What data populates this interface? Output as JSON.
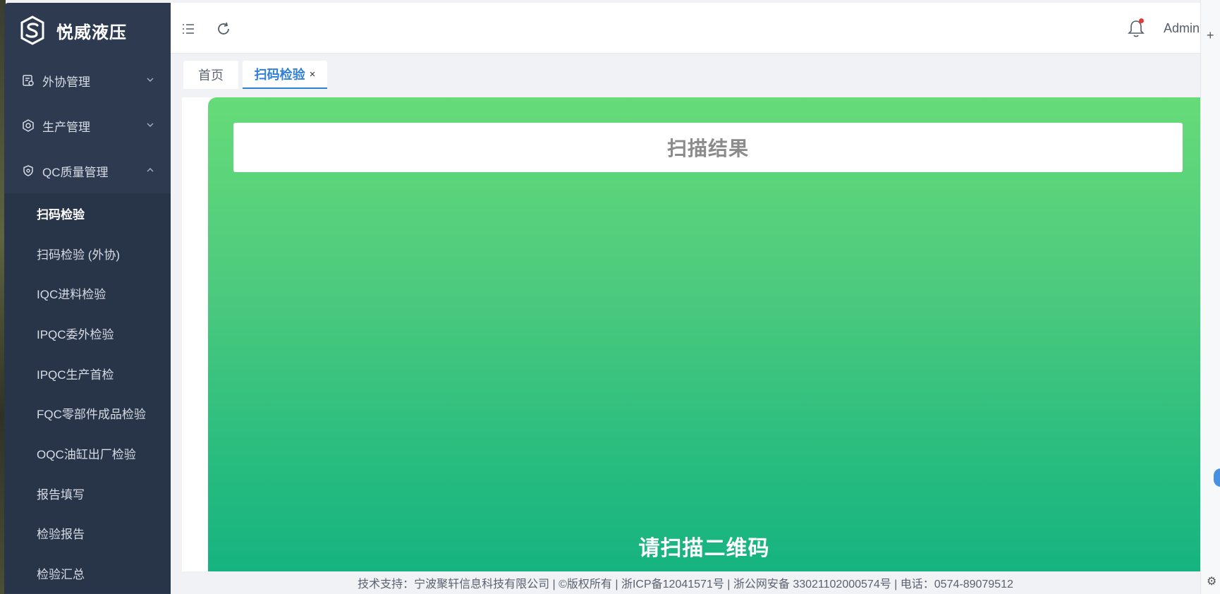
{
  "brand": {
    "name": "悦威液压"
  },
  "sidebar": {
    "menus": [
      {
        "label": "外协管理",
        "icon": "clipboard-icon",
        "expanded": false
      },
      {
        "label": "生产管理",
        "icon": "hexagon-icon",
        "expanded": false
      },
      {
        "label": "QC质量管理",
        "icon": "shield-icon",
        "expanded": true
      }
    ],
    "qc_items": [
      {
        "label": "扫码检验",
        "active": true
      },
      {
        "label": "扫码检验 (外协)"
      },
      {
        "label": "IQC进料检验"
      },
      {
        "label": "IPQC委外检验"
      },
      {
        "label": "IPQC生产首检"
      },
      {
        "label": "FQC零部件成品检验"
      },
      {
        "label": "OQC油缸出厂检验"
      },
      {
        "label": "报告填写"
      },
      {
        "label": "检验报告"
      },
      {
        "label": "检验汇总"
      }
    ]
  },
  "topbar": {
    "menu_toggle_icon": "list-icon",
    "refresh_icon": "refresh-icon",
    "notification_icon": "bell-icon",
    "user": "Admin"
  },
  "tabs": [
    {
      "label": "首页"
    },
    {
      "label": "扫码检验",
      "close": "×"
    }
  ],
  "scan": {
    "result_title": "扫描结果",
    "prompt": "请扫描二维码"
  },
  "footer": {
    "text": "技术支持：宁波聚轩信息科技有限公司 | ©版权所有 | 浙ICP备12041571号 | 浙公网安备 33021102000574号 | 电话：0574-89079512"
  },
  "right_rail": {
    "plus": "+",
    "gear": "⚙"
  },
  "colors": {
    "sidebar_bg": "#2d3a50",
    "accent": "#2f80d8",
    "card_top": "#66db78",
    "card_bottom": "#16b380"
  }
}
